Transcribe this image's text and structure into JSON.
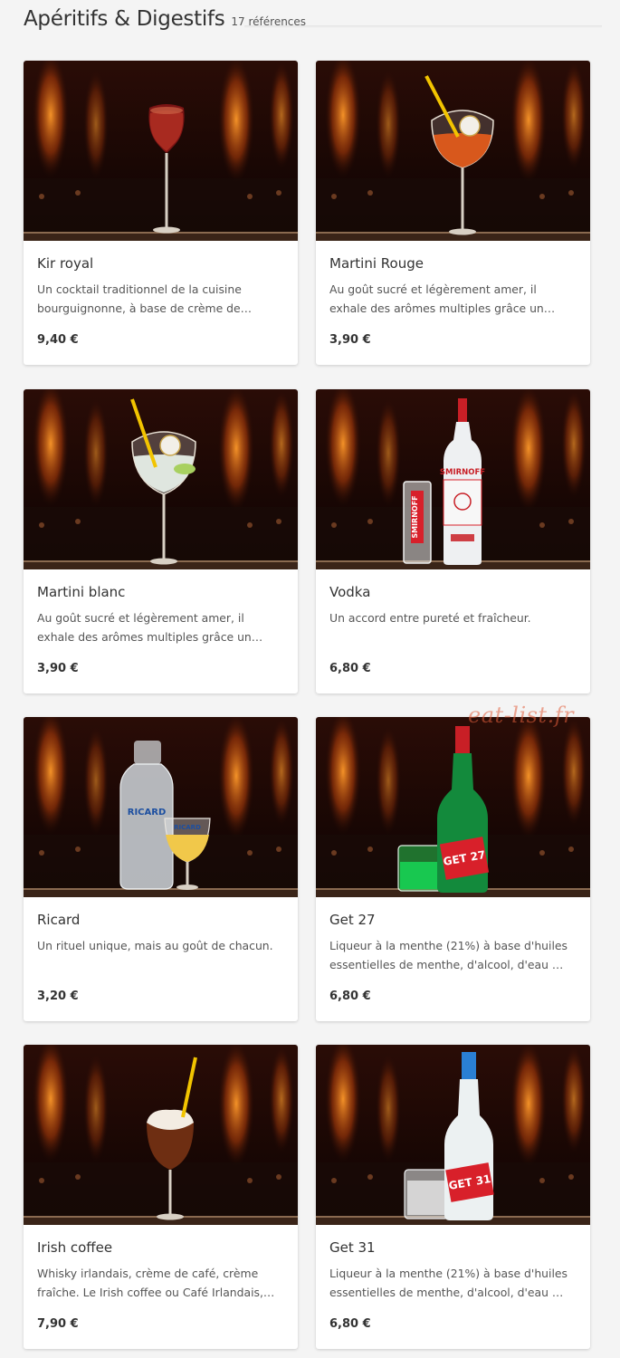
{
  "header": {
    "title": "Apéritifs & Digestifs",
    "count": "17 références"
  },
  "watermark": "eat-list.fr",
  "items": [
    {
      "name": "Kir royal",
      "desc": [
        "Un cocktail traditionnel de la cuisine",
        "bourguignonne, à base de crème de…"
      ],
      "price": "9,40 €",
      "photo": "kir-royal-glass"
    },
    {
      "name": "Martini Rouge",
      "desc": [
        "Au goût sucré et légèrement amer, il",
        "exhale des arômes multiples grâce un…"
      ],
      "price": "3,90 €",
      "photo": "martini-rouge-glass"
    },
    {
      "name": "Martini blanc",
      "desc": [
        "Au goût sucré et légèrement amer, il",
        "exhale des arômes multiples grâce un…"
      ],
      "price": "3,90 €",
      "photo": "martini-blanc-glass"
    },
    {
      "name": "Vodka",
      "desc": [
        "Un accord entre pureté et fraîcheur.",
        ""
      ],
      "price": "6,80 €",
      "photo": "vodka-bottle",
      "label": "SMIRNOFF",
      "label2": "SMIRNOFF"
    },
    {
      "name": "Ricard",
      "desc": [
        "Un rituel unique, mais au goût de chacun.",
        ""
      ],
      "price": "3,20 €",
      "photo": "ricard-carafe",
      "label": "RICARD",
      "label2": "RICARD"
    },
    {
      "name": "Get 27",
      "desc": [
        "Liqueur à la menthe (21%) à base d'huiles",
        "essentielles de menthe, d'alcool, d'eau …"
      ],
      "price": "6,80 €",
      "photo": "get27-bottle",
      "label": "GET 27"
    },
    {
      "name": "Irish coffee",
      "desc": [
        "Whisky irlandais, crème de café, crème",
        "fraîche. Le Irish coffee ou Café Irlandais,…"
      ],
      "price": "7,90 €",
      "photo": "irish-coffee-glass"
    },
    {
      "name": "Get 31",
      "desc": [
        "Liqueur à la menthe (21%) à base d'huiles",
        "essentielles de menthe, d'alcool, d'eau …"
      ],
      "price": "6,80 €",
      "photo": "get31-bottle",
      "label": "GET 31"
    }
  ]
}
